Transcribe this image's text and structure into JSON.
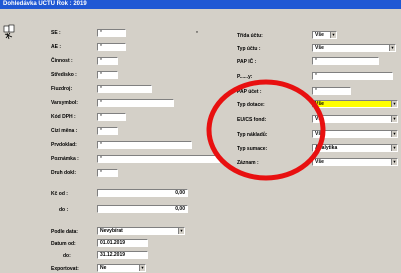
{
  "window": {
    "title": "Dohledávka UČTU  Rok : 2019"
  },
  "labels": {
    "se": "SE      :",
    "ae": "AE      :",
    "cinnost": "Činnost  :",
    "stredisko": "Středisko :",
    "fiuzdroj": "Fiuzdroj:",
    "varsymbol": "Varsymbol:",
    "kod_dph": "Kód DPH  :",
    "ciz_mena": "Cizí měna :",
    "prvdoklad": "Prvdoklad:",
    "poznamka": "Poznámka  :",
    "druh_dokl": "Druh dokl:",
    "kc_od": "Kč  od   :",
    "do": "do   :",
    "podle_data": "Podle data:",
    "datum_od": "Datum  od:",
    "datum_do": "do:",
    "exportovat": "Exportovat:",
    "trida_uctu": "Třída účtu:",
    "typ_uctu": "Typ účtu :",
    "pap_ic": "PAP IČ  :",
    "pap_hidden": "P......y:",
    "pap_ucet": "PAP účet  :",
    "typ_dotace": "Typ dotace:",
    "eu_cs_fond": "EU/CS fond:",
    "typ_nakladu": "Typ nákladů:",
    "typ_sumace": "Typ sumace:",
    "zaznam": "Záznam  :"
  },
  "values": {
    "wildcard": "*",
    "trida_uctu": "Vše",
    "typ_uctu": "Vše",
    "typ_dotace": "Vše",
    "eu_cs_fond": "Vše",
    "typ_nakladu": "Vše",
    "typ_sumace": "Analytika",
    "zaznam": "Vše",
    "kc_od": "0,00",
    "kc_do": "0,00",
    "podle_data": "Nevybírat",
    "datum_od": "01.01.2019",
    "datum_do": "31.12.2019",
    "exportovat": "Ne",
    "mark": "*"
  },
  "colors": {
    "titlebar": "#1f58d4",
    "highlight": "#ffff00",
    "annotation": "#e81010"
  }
}
